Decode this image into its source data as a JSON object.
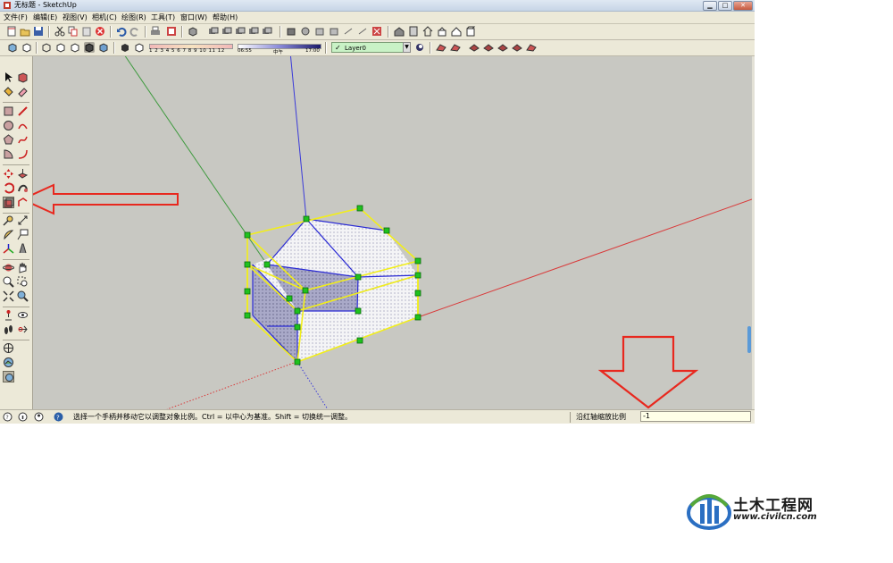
{
  "window": {
    "title": "无标题 - SketchUp",
    "buttons": [
      "minimize",
      "maximize",
      "close"
    ]
  },
  "menu": {
    "items": [
      "文件(F)",
      "编辑(E)",
      "视图(V)",
      "相机(C)",
      "绘图(R)",
      "工具(T)",
      "窗口(W)",
      "帮助(H)"
    ]
  },
  "toolbar2": {
    "shadow_month_labels": "1 2 3 4 5 6 7 8 9 10 11 12",
    "time_start": "06:55",
    "time_mid": "中午",
    "time_end": "17:00",
    "layer": "Layer0"
  },
  "status": {
    "message": "选择一个手柄并移动它以调整对象比例。Ctrl = 以中心为基准。Shift = 切换统一调整。",
    "measure_label": "沿红轴缩放比例",
    "measure_value": "-1"
  },
  "watermark": {
    "title": "土木工程网",
    "url": "www.civilcn.com"
  },
  "colors": {
    "axis_red": "#d93a3a",
    "axis_green": "#3e9a3e",
    "axis_blue": "#3a3ad9",
    "selection_yellow": "#f2ee1a",
    "grip_green": "#1ec21e",
    "annotation_arrow": "#e8281e"
  }
}
